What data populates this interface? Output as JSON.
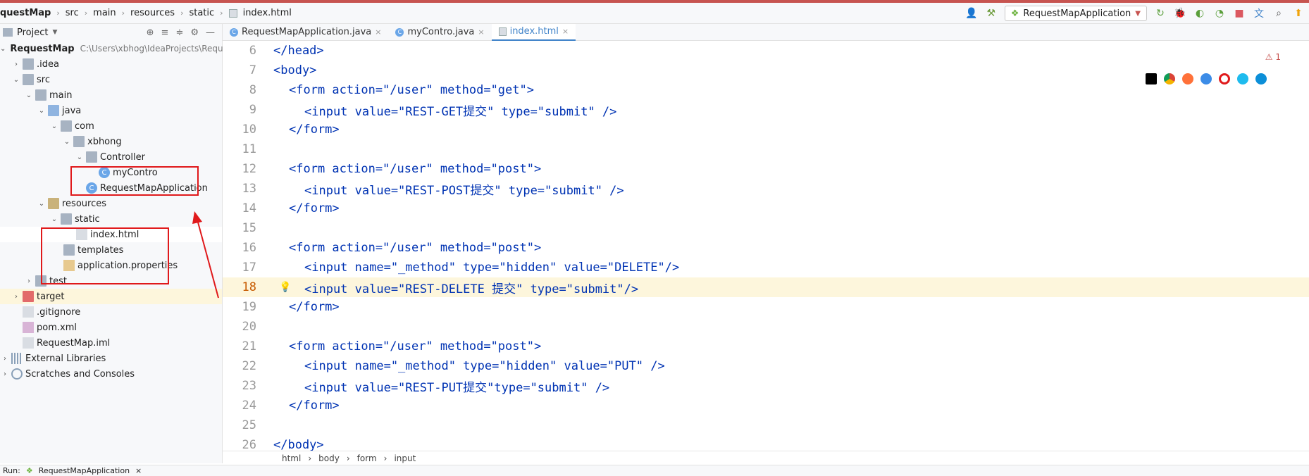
{
  "breadcrumb": [
    "questMap",
    "src",
    "main",
    "resources",
    "static",
    "index.html"
  ],
  "run_config": {
    "label": "RequestMapApplication"
  },
  "sidebar": {
    "title": "Project",
    "tree": [
      {
        "label": "RequestMap",
        "extra": "C:\\Users\\xbhog\\IdeaProjects\\Requ",
        "bold": true,
        "depth": 0
      },
      {
        "label": ".idea",
        "depth": 1
      },
      {
        "label": "src",
        "depth": 1
      },
      {
        "label": "main",
        "depth": 2
      },
      {
        "label": "java",
        "depth": 3
      },
      {
        "label": "com",
        "depth": 4
      },
      {
        "label": "xbhong",
        "depth": 5
      },
      {
        "label": "Controller",
        "depth": 6
      },
      {
        "label": "myContro",
        "depth": 7
      },
      {
        "label": "RequestMapApplication",
        "depth": 6
      },
      {
        "label": "resources",
        "depth": 3
      },
      {
        "label": "static",
        "depth": 4
      },
      {
        "label": "index.html",
        "depth": 5
      },
      {
        "label": "templates",
        "depth": 4
      },
      {
        "label": "application.properties",
        "depth": 4
      },
      {
        "label": "test",
        "depth": 2
      },
      {
        "label": "target",
        "depth": 1
      },
      {
        "label": ".gitignore",
        "depth": 1
      },
      {
        "label": "pom.xml",
        "depth": 1
      },
      {
        "label": "RequestMap.iml",
        "depth": 1
      },
      {
        "label": "External Libraries",
        "depth": 0
      },
      {
        "label": "Scratches and Consoles",
        "depth": 0
      }
    ]
  },
  "tabs": [
    {
      "label": "RequestMapApplication.java"
    },
    {
      "label": "myContro.java"
    },
    {
      "label": "index.html"
    }
  ],
  "warning_count": "1",
  "code_lines": [
    {
      "n": "6",
      "text": "</head>"
    },
    {
      "n": "7",
      "text": "<body>"
    },
    {
      "n": "8",
      "text": "<form action=\"/user\" method=\"get\">"
    },
    {
      "n": "9",
      "text": "<input value=\"REST-GET提交\" type=\"submit\" />"
    },
    {
      "n": "10",
      "text": "</form>"
    },
    {
      "n": "11",
      "text": ""
    },
    {
      "n": "12",
      "text": "<form action=\"/user\" method=\"post\">"
    },
    {
      "n": "13",
      "text": "<input value=\"REST-POST提交\" type=\"submit\" />"
    },
    {
      "n": "14",
      "text": "</form>"
    },
    {
      "n": "15",
      "text": ""
    },
    {
      "n": "16",
      "text": "<form action=\"/user\" method=\"post\">"
    },
    {
      "n": "17",
      "text": "<input name=\"_method\" type=\"hidden\" value=\"DELETE\"/>"
    },
    {
      "n": "18",
      "text": "<input value=\"REST-DELETE 提交\" type=\"submit\"/>"
    },
    {
      "n": "19",
      "text": "</form>"
    },
    {
      "n": "20",
      "text": ""
    },
    {
      "n": "21",
      "text": "<form action=\"/user\" method=\"post\">"
    },
    {
      "n": "22",
      "text": "<input name=\"_method\" type=\"hidden\" value=\"PUT\" />"
    },
    {
      "n": "23",
      "text": "<input value=\"REST-PUT提交\"type=\"submit\" />"
    },
    {
      "n": "24",
      "text": "</form>"
    },
    {
      "n": "25",
      "text": ""
    },
    {
      "n": "26",
      "text": "</body>"
    }
  ],
  "status_path": [
    "html",
    "body",
    "form",
    "input"
  ],
  "bottom": {
    "run_label": "Run:",
    "tab": "RequestMapApplication"
  }
}
